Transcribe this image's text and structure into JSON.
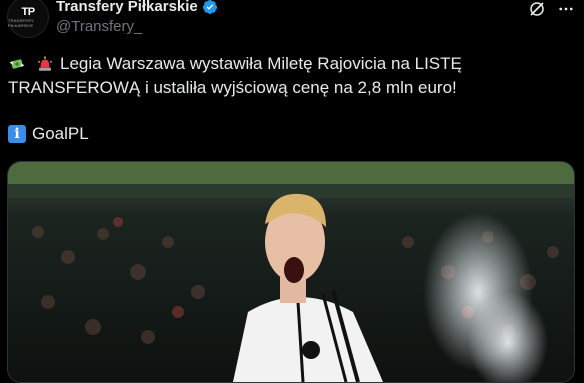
{
  "account": {
    "display_name": "Transfery Piłkarskie",
    "handle": "@Transfery_",
    "avatar_text": "TP",
    "avatar_subtext": "TRANSFERY PIŁKARSKIE"
  },
  "tweet": {
    "line1": "Legia Warszawa wystawiła Miletę Rajovicia na LISTĘ",
    "line2": "TRANSFEROWĄ i ustaliła wyjściową cenę na 2,8 mln euro!",
    "source": "GoalPL"
  },
  "media": {
    "icons": [
      "money-with-wings-icon",
      "police-light-icon",
      "info-icon"
    ]
  },
  "colors": {
    "background": "#000000",
    "text": "#e7e9ea",
    "secondary": "#71767b",
    "verified": "#1d9bf0",
    "info": "#3b8ee8"
  }
}
